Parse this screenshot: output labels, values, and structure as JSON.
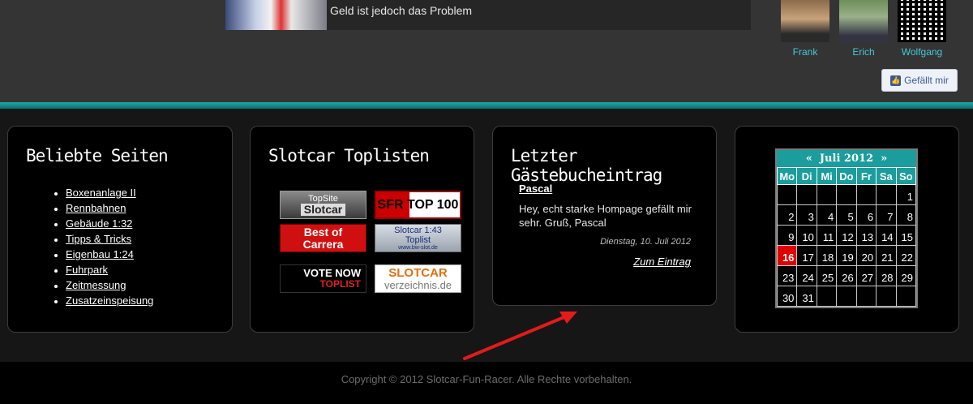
{
  "top": {
    "news_text": "Geld ist jedoch das Problem",
    "friends": [
      {
        "name": "Frank"
      },
      {
        "name": "Erich"
      },
      {
        "name": "Wolfgang"
      }
    ],
    "like_label": "Gefällt mir"
  },
  "boxes": {
    "popular": {
      "title": "Beliebte Seiten",
      "links": [
        "Boxenanlage II",
        "Rennbahnen",
        "Gebäude 1:32",
        "Tipps & Tricks",
        "Eigenbau 1:24",
        "Fuhrpark",
        "Zeitmessung",
        "Zusatzeinspeisung"
      ]
    },
    "toplists": {
      "title": "Slotcar Toplisten",
      "banners": [
        {
          "line1": "TopSite",
          "line2": "Slotcar"
        },
        {
          "line1": "SFR TOP 100"
        },
        {
          "line1": "Best of",
          "line2": "Carrera"
        },
        {
          "line1": "Slotcar 1:43",
          "line2": "Toplist",
          "line3": "www.bw-slot.de"
        },
        {
          "line1": "VOTE NOW",
          "line2": "TOPLIST"
        },
        {
          "line1": "SLOTCAR",
          "line2": "verzeichnis.de"
        }
      ]
    },
    "guestbook": {
      "title": "Letzter Gästebucheintrag",
      "author": "Pascal",
      "text": "Hey, echt starke Hompage gefällt mir sehr. Gruß, Pascal",
      "date": "Dienstag, 10. Juli 2012",
      "link": "Zum Eintrag"
    },
    "calendar": {
      "prev": "«",
      "month": "Juli 2012",
      "next": "»",
      "weekdays": [
        "Mo",
        "Di",
        "Mi",
        "Do",
        "Fr",
        "Sa",
        "So"
      ],
      "days": [
        "",
        "",
        "",
        "",
        "",
        "",
        "1",
        "2",
        "3",
        "4",
        "5",
        "6",
        "7",
        "8",
        "9",
        "10",
        "11",
        "12",
        "13",
        "14",
        "15",
        "16",
        "17",
        "18",
        "19",
        "20",
        "21",
        "22",
        "23",
        "24",
        "25",
        "26",
        "27",
        "28",
        "29",
        "30",
        "31",
        "",
        "",
        "",
        "",
        ""
      ],
      "today": "16"
    }
  },
  "footer": {
    "copyright": "Copyright © 2012 Slotcar-Fun-Racer. Alle Rechte vorbehalten."
  }
}
